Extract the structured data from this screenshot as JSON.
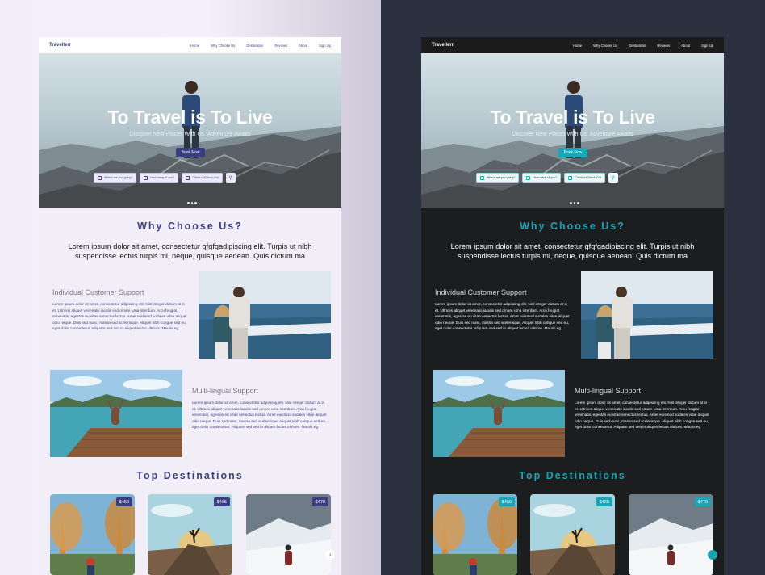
{
  "brand": "Travellerr",
  "nav": [
    "Home",
    "Why Choose Us",
    "Destination",
    "Reviews",
    "About",
    "Sign Up"
  ],
  "hero": {
    "title": "To Travel is To Live",
    "subtitle": "Discover New Places With Us, Adventure Awaits",
    "cta": "Book Now",
    "search": {
      "where": "Where are you going?",
      "guests": "How many of you?",
      "dates": "Check-In/Check-Out"
    }
  },
  "why": {
    "title": "Why Choose Us?",
    "lead": "Lorem ipsum dolor sit amet, consectetur gfgfgadipiscing elit. Turpis ut nibh suspendisse lectus turpis mi, neque, quisque aenean. Quis dictum ma"
  },
  "features": [
    {
      "title": "Individual Customer Support",
      "text": "Lorem ipsum dolor sit amet, consectetur adipiscing elit. Nisl integer dictum at in et. Ultrices aliquet venenatis iaculis sed ornare urna interdum. Arcu feugiat venenatis, egestas eu vitae senectus lectus. Amet euismod sodales vitae aliquet odio neque. Duis sed nunc, massa sed scelerisque. Aliquet nibh congue sed eu, eget dolor consectetur. Aliquam sed sed in aliquet lectus ultrices. Mauris eg"
    },
    {
      "title": "Multi-lingual Support",
      "text": "Lorem ipsum dolor sit amet, consectetur adipiscing elit. Nisl integer dictum at in et. Ultrices aliquet venenatis iaculis sed ornare urna interdum. Arcu feugiat venenatis, egestas eu vitae senectus lectus. Amet euismod sodales vitae aliquet odio neque. Duis sed nunc, massa sed scelerisque. Aliquet nibh congue sed eu, eget dolor consectetur. Aliquam sed sed in aliquet lectus ultrices. Mauris eg"
    }
  ],
  "destinations": {
    "title": "Top Destinations",
    "prices": [
      "$450",
      "$465",
      "$470"
    ]
  },
  "colors": {
    "light_accent": "#3b3e82",
    "dark_accent": "#17a7b8",
    "dark_bg": "#1c1d1f",
    "light_bg": "#f2eef8"
  },
  "icons": {
    "search": "magnifier",
    "next": "chevron-right"
  }
}
